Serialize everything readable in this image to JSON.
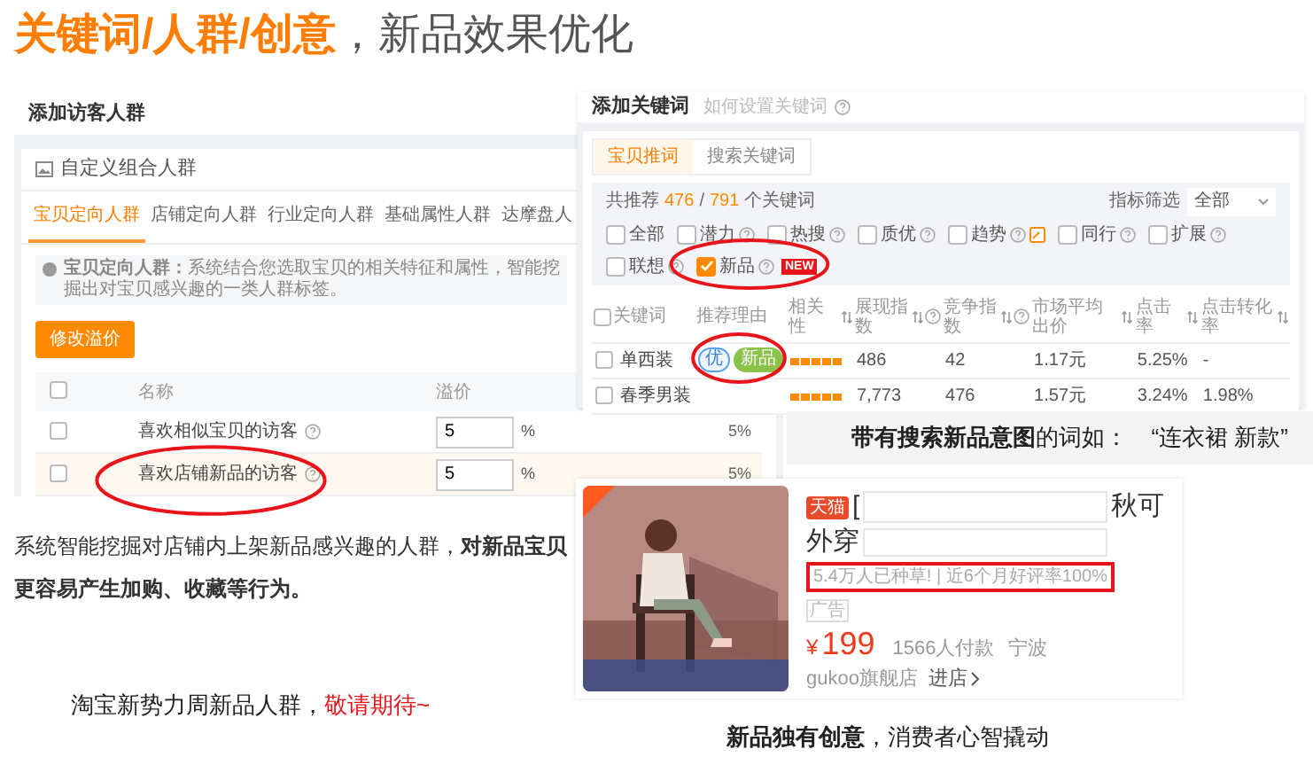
{
  "title": {
    "highlight": "关键词/人群/创意",
    "rest": "，新品效果优化"
  },
  "audience_panel": {
    "header": "添加访客人群",
    "card_title": "自定义组合人群",
    "tabs": [
      {
        "label": "宝贝定向人群",
        "selected": true
      },
      {
        "label": "店铺定向人群",
        "selected": false
      },
      {
        "label": "行业定向人群",
        "selected": false
      },
      {
        "label": "基础属性人群",
        "selected": false
      },
      {
        "label": "达摩盘人",
        "selected": false
      }
    ],
    "info_label": "宝贝定向人群：",
    "info_text": "系统结合您选取宝贝的相关特征和属性，智能挖掘出对宝贝感兴趣的一类人群标签。",
    "edit_button": "修改溢价",
    "select_all_checked": false,
    "columns": [
      "名称",
      "溢价"
    ],
    "rows": [
      {
        "name": "喜欢相似宝贝的访客",
        "premium": "5",
        "unit": "%",
        "column_3": "5%",
        "checked": false,
        "highlighted": false,
        "circled": false
      },
      {
        "name": "喜欢店铺新品的访客",
        "premium": "5",
        "unit": "%",
        "column_3": "5%",
        "checked": false,
        "highlighted": true,
        "circled": true
      }
    ]
  },
  "keyword_panel": {
    "header": "添加关键词",
    "help_link": "如何设置关键词",
    "tabs": [
      {
        "label": "宝贝推词",
        "selected": true
      },
      {
        "label": "搜索关键词",
        "selected": false
      }
    ],
    "count_prefix": "共推荐",
    "count_shown": "476",
    "count_separator": "/",
    "count_total": "791",
    "count_suffix": "个关键词",
    "filter_label": "指标筛选",
    "filter_value": "全部",
    "filters": [
      {
        "label": "全部",
        "kind": "plain",
        "checked": false,
        "circled": false
      },
      {
        "label": "潜力",
        "kind": "help",
        "checked": false,
        "circled": false
      },
      {
        "label": "热搜",
        "kind": "help",
        "checked": false,
        "circled": false
      },
      {
        "label": "质优",
        "kind": "help",
        "checked": false,
        "circled": false
      },
      {
        "label": "趋势",
        "kind": "help_note",
        "checked": false,
        "circled": false
      },
      {
        "label": "同行",
        "kind": "help",
        "checked": false,
        "circled": false
      },
      {
        "label": "扩展",
        "kind": "help",
        "checked": false,
        "circled": false
      },
      {
        "label": "联想",
        "kind": "help",
        "checked": false,
        "circled": false
      },
      {
        "label": "新品",
        "kind": "help_badge",
        "checked": true,
        "circled": true,
        "badge": "NEW"
      }
    ],
    "select_all_checked": false,
    "columns": [
      {
        "label": "关键词",
        "kind": "plain"
      },
      {
        "label": "推荐理由",
        "kind": "plain"
      },
      {
        "label": "相关性",
        "kind": "sortable"
      },
      {
        "label": "展现指数",
        "kind": "sortable_help"
      },
      {
        "label": "竞争指数",
        "kind": "sortable_help"
      },
      {
        "label": "市场平均出价",
        "kind": "sortable"
      },
      {
        "label": "点击率",
        "kind": "sortable"
      },
      {
        "label": "点击转化率",
        "kind": "sortable"
      }
    ],
    "rows": [
      {
        "keyword": "单西装",
        "checked": false,
        "reasons": [
          {
            "label": "优",
            "kind": "quality"
          },
          {
            "label": "新品",
            "kind": "new"
          }
        ],
        "reasons_circled": true,
        "stars": 5,
        "impressions": "486",
        "competition": "42",
        "avg_bid": "1.17元",
        "ctr": "5.25%",
        "conversion": "-"
      },
      {
        "keyword": "春季男装",
        "checked": false,
        "reasons": [],
        "reasons_circled": false,
        "stars": 5,
        "impressions": "7,773",
        "competition": "476",
        "avg_bid": "1.57元",
        "ctr": "3.24%",
        "conversion": "1.98%"
      }
    ]
  },
  "keyword_caption": "**带有搜索新品意图**的词如：　“连衣裙 新款”",
  "audience_caption": "系统智能挖掘对店铺内上架新品感兴趣的人群，**对新品宝贝更容易产生加购、收藏等行为。**",
  "teaser": {
    "text": "淘宝新势力周新品人群，",
    "highlight": "敬请期待~"
  },
  "product": {
    "store_badge": "天猫",
    "title_start": "[",
    "title_end": "秋可",
    "title_line2": "外穿",
    "highlight": "5.4万人已种草! | 近6个月好评率100%",
    "ad_tag": "广告",
    "currency": "¥",
    "price": "199",
    "sales": "1566人付款",
    "location": "宁波",
    "store": "gukoo旗舰店",
    "enter_store": "进店"
  },
  "creative_caption": "**新品独有创意**，消费者心智撬动"
}
